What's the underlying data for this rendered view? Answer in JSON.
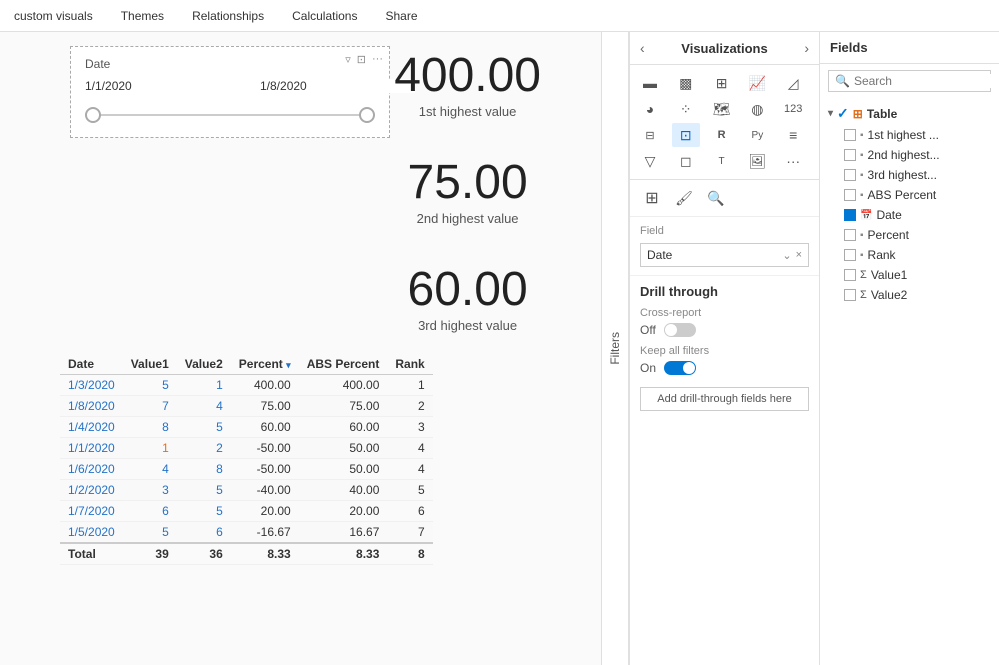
{
  "toolbar": {
    "items": [
      "custom visuals",
      "Themes",
      "Relationships",
      "Calculations",
      "Share"
    ]
  },
  "dateFilter": {
    "label": "Date",
    "startDate": "1/1/2020",
    "endDate": "1/8/2020"
  },
  "kpis": [
    {
      "value": "400.00",
      "label": "1st highest value"
    },
    {
      "value": "75.00",
      "label": "2nd highest value"
    },
    {
      "value": "60.00",
      "label": "3rd highest value"
    }
  ],
  "table": {
    "headers": [
      "Date",
      "Value1",
      "Value2",
      "Percent",
      "ABS Percent",
      "Rank"
    ],
    "rows": [
      {
        "date": "1/3/2020",
        "v1": "5",
        "v2": "1",
        "pct": "400.00",
        "abs": "400.00",
        "rank": "1",
        "v1Orange": false
      },
      {
        "date": "1/8/2020",
        "v1": "7",
        "v2": "4",
        "pct": "75.00",
        "abs": "75.00",
        "rank": "2",
        "v1Orange": false
      },
      {
        "date": "1/4/2020",
        "v1": "8",
        "v2": "5",
        "pct": "60.00",
        "abs": "60.00",
        "rank": "3",
        "v1Orange": false
      },
      {
        "date": "1/1/2020",
        "v1": "1",
        "v2": "2",
        "pct": "-50.00",
        "abs": "50.00",
        "rank": "4",
        "v1Orange": true
      },
      {
        "date": "1/6/2020",
        "v1": "4",
        "v2": "8",
        "pct": "-50.00",
        "abs": "50.00",
        "rank": "4",
        "v1Orange": false
      },
      {
        "date": "1/2/2020",
        "v1": "3",
        "v2": "5",
        "pct": "-40.00",
        "abs": "40.00",
        "rank": "5",
        "v1Orange": false
      },
      {
        "date": "1/7/2020",
        "v1": "6",
        "v2": "5",
        "pct": "20.00",
        "abs": "20.00",
        "rank": "6",
        "v1Orange": false
      },
      {
        "date": "1/5/2020",
        "v1": "5",
        "v2": "6",
        "pct": "-16.67",
        "abs": "16.67",
        "rank": "7",
        "v1Orange": false
      }
    ],
    "footer": {
      "label": "Total",
      "v1": "39",
      "v2": "36",
      "pct": "8.33",
      "abs": "8.33",
      "rank": "8"
    }
  },
  "vizPanel": {
    "title": "Visualizations",
    "fieldLabel": "Field",
    "fieldValue": "Date",
    "drillThrough": {
      "title": "Drill through",
      "crossReportLabel": "Cross-report",
      "crossReportState": "Off",
      "keepAllFiltersLabel": "Keep all filters",
      "keepAllFiltersState": "On",
      "addButtonLabel": "Add drill-through fields here"
    }
  },
  "fieldsPanel": {
    "title": "Fields",
    "searchPlaceholder": "Search",
    "groups": [
      {
        "name": "Table",
        "icon": "table",
        "expanded": true,
        "fields": [
          {
            "name": "1st highest ...",
            "type": "measure",
            "checked": false
          },
          {
            "name": "2nd highest...",
            "type": "measure",
            "checked": false
          },
          {
            "name": "3rd highest...",
            "type": "measure",
            "checked": false
          },
          {
            "name": "ABS Percent",
            "type": "measure",
            "checked": false
          },
          {
            "name": "Date",
            "type": "date",
            "checked": true
          },
          {
            "name": "Percent",
            "type": "measure",
            "checked": false
          },
          {
            "name": "Rank",
            "type": "measure",
            "checked": false
          },
          {
            "name": "Value1",
            "type": "sigma",
            "checked": false
          },
          {
            "name": "Value2",
            "type": "sigma",
            "checked": false
          }
        ]
      }
    ]
  }
}
